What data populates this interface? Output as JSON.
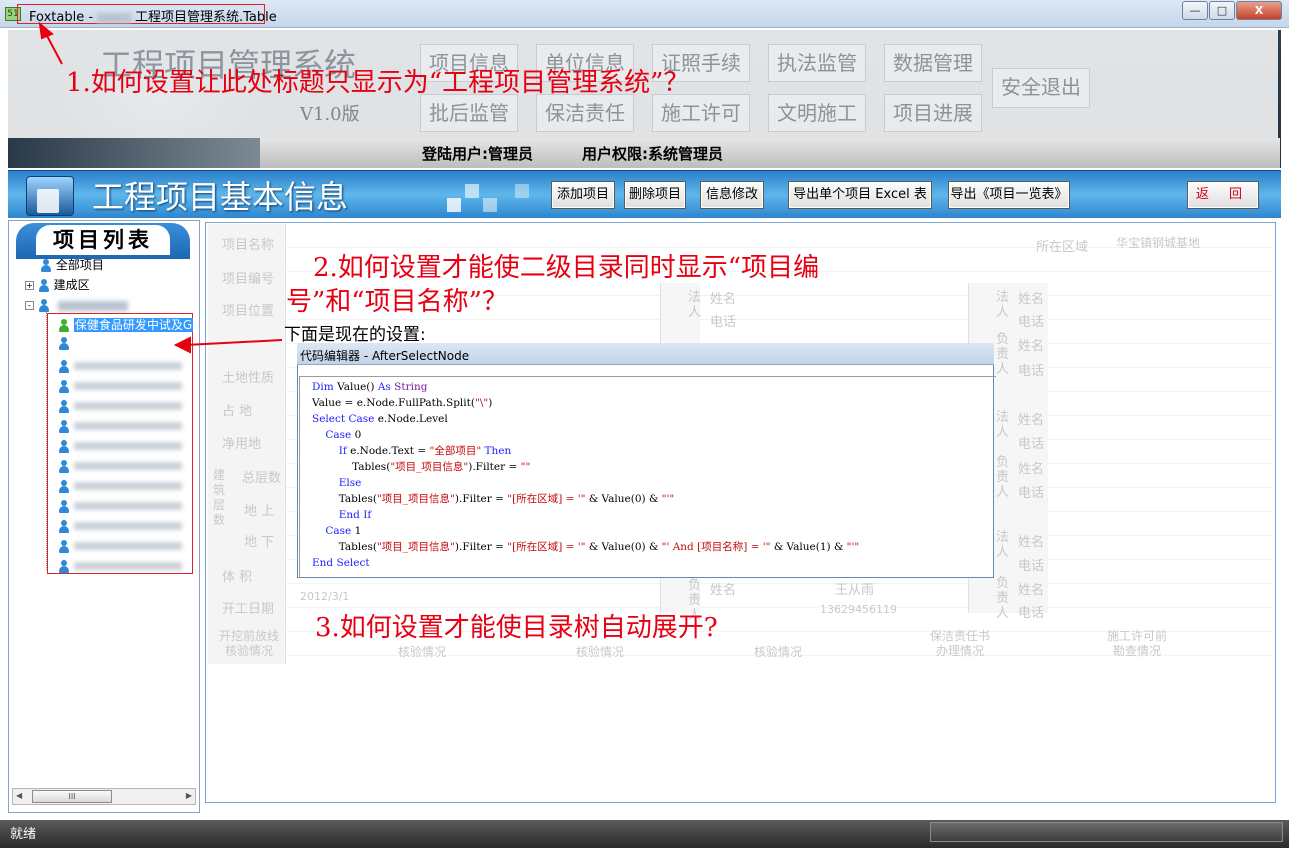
{
  "window": {
    "app_name": "Foxtable -",
    "title_suffix": "工程项目管理系统.Table",
    "controls": {
      "minimize": "—",
      "maximize": "□",
      "close": "X"
    }
  },
  "banner": {
    "system_title": "工程项目管理系统",
    "version": "V1.0版",
    "nav_row1": [
      "项目信息",
      "单位信息",
      "证照手续",
      "执法监管",
      "数据管理"
    ],
    "nav_row2": [
      "批后监管",
      "保洁责任",
      "施工许可",
      "文明施工",
      "项目进展"
    ],
    "logout": "安全退出",
    "user_label": "登陆用户:管理员",
    "role_label": "用户权限:系统管理员"
  },
  "header": {
    "title": "工程项目基本信息",
    "buttons": [
      "添加项目",
      "删除项目",
      "信息修改",
      "导出单个项目 Excel 表",
      "导出《项目一览表》"
    ],
    "back": "返 回"
  },
  "tree": {
    "title": "项目列表",
    "root": "全部项目",
    "district": "建成区",
    "selected_node": "保健食品研发中试及G",
    "hscroll_grip": "III"
  },
  "form_labels": {
    "project_name": "项目名称",
    "project_no": "项目编号",
    "project_location": "项目位置",
    "land_nature": "土地性质",
    "occupied": "占 地",
    "net_land": "净用地",
    "building_layers": "建筑层数",
    "total_layers": "总层数",
    "above": "地 上",
    "below": "地 下",
    "volume": "体 积",
    "start_date": "开工日期",
    "start_date_value": "2012/3/1",
    "district": "所在区域",
    "district_value": "华宝镇钢城基地",
    "legal": "法人",
    "responsible": "负责人",
    "name": "姓名",
    "phone": "电话",
    "contact_name": "王从雨",
    "contact_phone": "13629456119",
    "check_1": "开挖前放线核验情况",
    "check_2": "核验情况",
    "check_3": "核验情况",
    "check_4": "核验情况",
    "check_5": "保洁责任书办理情况",
    "check_6": "施工许可前勘查情况"
  },
  "annotations": {
    "q1": "1.如何设置让此处标题只显示为“工程项目管理系统”？",
    "q2_line1": "2.如何设置才能使二级目录同时显示“项目编",
    "q2_line2": "号”和“项目名称”？",
    "current_setting": "下面是现在的设置:",
    "q3": "3.如何设置才能使目录树自动展开?",
    "color": "#e60012"
  },
  "code_editor": {
    "title": "代码编辑器 - AfterSelectNode",
    "lines": [
      "Dim Value() As String",
      "Value = e.Node.FullPath.Split(\"\\\")",
      "Select Case e.Node.Level",
      "    Case 0",
      "        If e.Node.Text = \"全部项目\" Then",
      "            Tables(\"项目_项目信息\").Filter = \"\"",
      "        Else",
      "        Tables(\"项目_项目信息\").Filter = \"[所在区域] = '\" & Value(0) & \"'\"",
      "        End If",
      "    Case 1",
      "        Tables(\"项目_项目信息\").Filter = \"[所在区域] = '\" & Value(0) & \"' And [项目名称] = '\" & Value(1) & \"'\"",
      "End Select"
    ]
  },
  "status": {
    "text": "就绪"
  }
}
